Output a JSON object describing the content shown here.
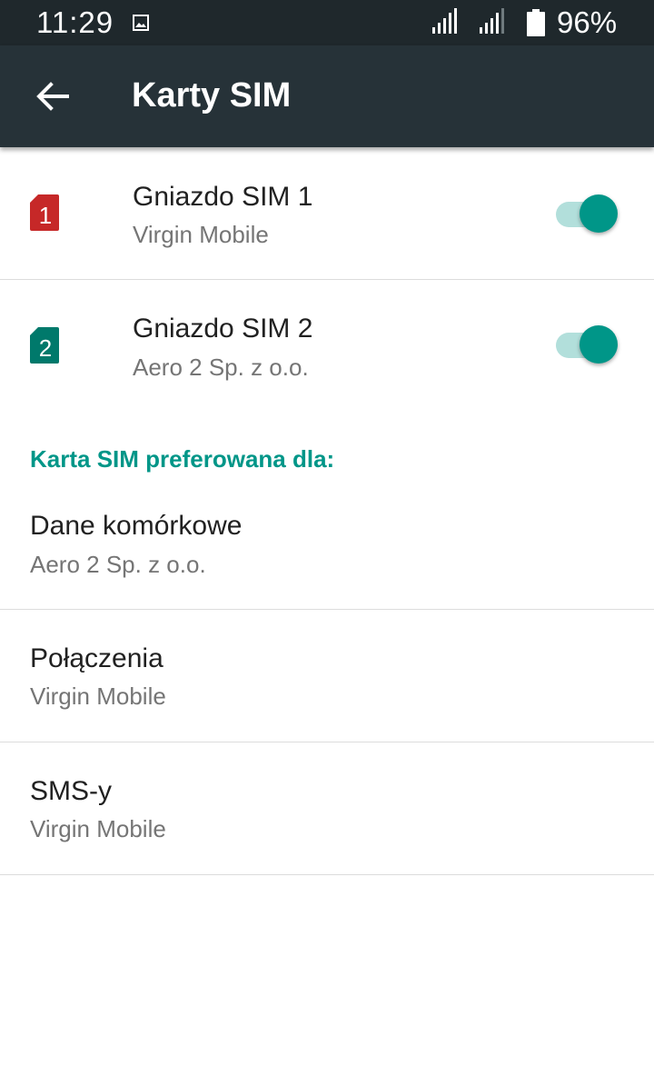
{
  "status_bar": {
    "time": "11:29",
    "battery": "96%",
    "icons": [
      "image-icon",
      "signal-icon",
      "signal-icon",
      "battery-icon"
    ]
  },
  "app_bar": {
    "title": "Karty SIM",
    "back_icon": "arrow-back-icon"
  },
  "sim_slots": [
    {
      "badge": "1",
      "badge_color": "#c62828",
      "title": "Gniazdo SIM 1",
      "carrier": "Virgin Mobile",
      "enabled": true
    },
    {
      "badge": "2",
      "badge_color": "#00796b",
      "title": "Gniazdo SIM 2",
      "carrier": "Aero 2 Sp. z o.o.",
      "enabled": true
    }
  ],
  "preferred": {
    "header": "Karta SIM preferowana dla:",
    "items": [
      {
        "title": "Dane komórkowe",
        "value": "Aero 2 Sp. z o.o."
      },
      {
        "title": "Połączenia",
        "value": "Virgin Mobile"
      },
      {
        "title": "SMS-y",
        "value": "Virgin Mobile"
      }
    ]
  },
  "colors": {
    "accent": "#009688",
    "toggle_track": "#b2dfdb",
    "app_bar": "#263238",
    "status_bar": "#1f282c"
  }
}
